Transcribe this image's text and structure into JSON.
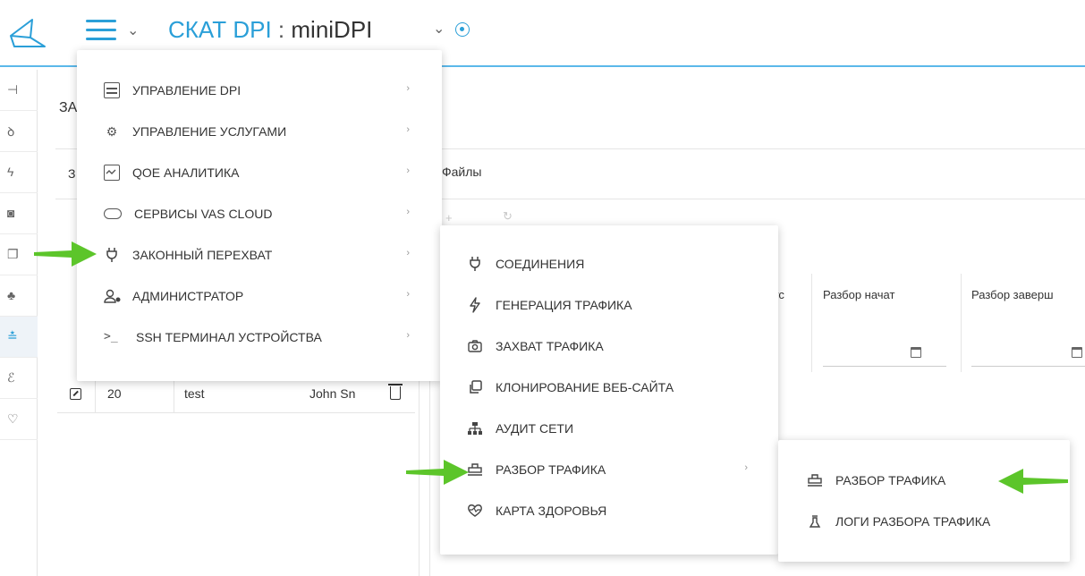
{
  "header": {
    "brand": "СКАТ DPI",
    "separator": ":",
    "device": "miniDPI"
  },
  "background": {
    "section_title": "ЗА",
    "files_label": "Файлы",
    "row_prefix_3": "З",
    "columns": [
      "ус",
      "Разбор начат",
      "Разбор заверш"
    ],
    "row": {
      "id": "20",
      "name": "test",
      "user": "John Sn"
    }
  },
  "main_menu": {
    "items": [
      {
        "label": "УПРАВЛЕНИЕ DPI",
        "icon": "server-icon"
      },
      {
        "label": "УПРАВЛЕНИЕ УСЛУГАМИ",
        "icon": "gears-icon"
      },
      {
        "label": "QOE АНАЛИТИКА",
        "icon": "chart-icon"
      },
      {
        "label": "СЕРВИСЫ VAS CLOUD",
        "icon": "cloud-icon"
      },
      {
        "label": "ЗАКОННЫЙ ПЕРЕХВАТ",
        "icon": "plug-icon"
      },
      {
        "label": "АДМИНИСТРАТОР",
        "icon": "admin-icon"
      },
      {
        "label": "SSH ТЕРМИНАЛ УСТРОЙСТВА",
        "icon": "terminal-icon"
      }
    ],
    "arrow": "›"
  },
  "sub_menu": {
    "items": [
      {
        "label": "СОЕДИНЕНИЯ",
        "icon": "plug-icon"
      },
      {
        "label": "ГЕНЕРАЦИЯ ТРАФИКА",
        "icon": "bolt-icon"
      },
      {
        "label": "ЗАХВАТ ТРАФИКА",
        "icon": "camera-icon"
      },
      {
        "label": "КЛОНИРОВАНИЕ ВЕБ-САЙТА",
        "icon": "clone-icon"
      },
      {
        "label": "АУДИТ СЕТИ",
        "icon": "network-icon"
      },
      {
        "label": "РАЗБОР ТРАФИКА",
        "icon": "analysis-icon"
      },
      {
        "label": "КАРТА ЗДОРОВЬЯ",
        "icon": "heart-icon"
      }
    ],
    "arrow": "›"
  },
  "sub_sub_menu": {
    "items": [
      {
        "label": "РАЗБОР ТРАФИКА",
        "icon": "analysis-icon"
      },
      {
        "label": "ЛОГИ РАЗБОРА ТРАФИКА",
        "icon": "logs-icon"
      }
    ]
  },
  "colors": {
    "accent": "#2a9fd8",
    "arrow_green": "#5cc52a"
  }
}
